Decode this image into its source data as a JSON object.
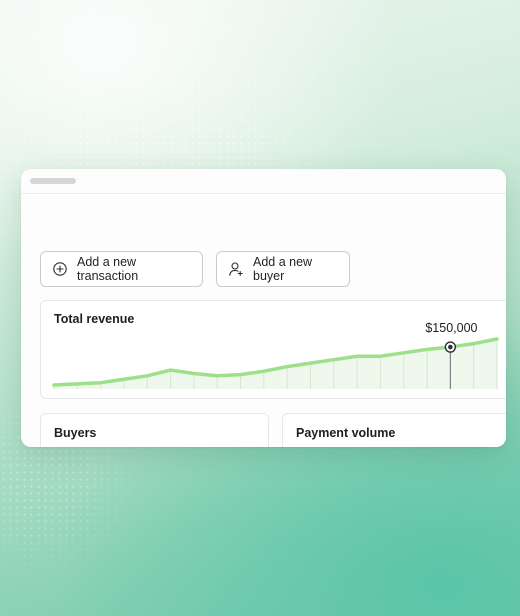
{
  "actions": {
    "add_transaction_label": "Add a new transaction",
    "add_buyer_label": "Add a new buyer"
  },
  "revenue_card": {
    "title": "Total revenue",
    "highlight_value": "$150,000"
  },
  "buyers_card": {
    "title": "Buyers"
  },
  "payment_card": {
    "title": "Payment volume"
  },
  "colors": {
    "line": "#9ee08a",
    "area": "#eef8ec",
    "marker": "#2e3133"
  },
  "chart_data": {
    "type": "line",
    "title": "Total revenue",
    "y": [
      0,
      0.5,
      1,
      2.5,
      4,
      6.5,
      5,
      4,
      4.5,
      6,
      8,
      9.5,
      11,
      12.5,
      12.5,
      14,
      15.5,
      16.5,
      18,
      20
    ],
    "highlight_index": 17,
    "highlight_label": "$150,000",
    "grid": "vertical",
    "legend": "none"
  }
}
